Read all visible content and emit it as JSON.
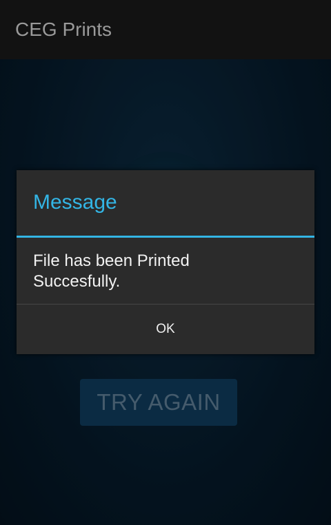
{
  "action_bar": {
    "title": "CEG Prints"
  },
  "background": {
    "try_again_label": "TRY AGAIN"
  },
  "dialog": {
    "title": "Message",
    "message_line1": "File has been Printed",
    "message_line2": "Succesfully.",
    "ok_label": "OK"
  },
  "colors": {
    "accent": "#33b5e5",
    "dialog_background": "#2b2b2b",
    "action_bar_background": "#121212"
  }
}
